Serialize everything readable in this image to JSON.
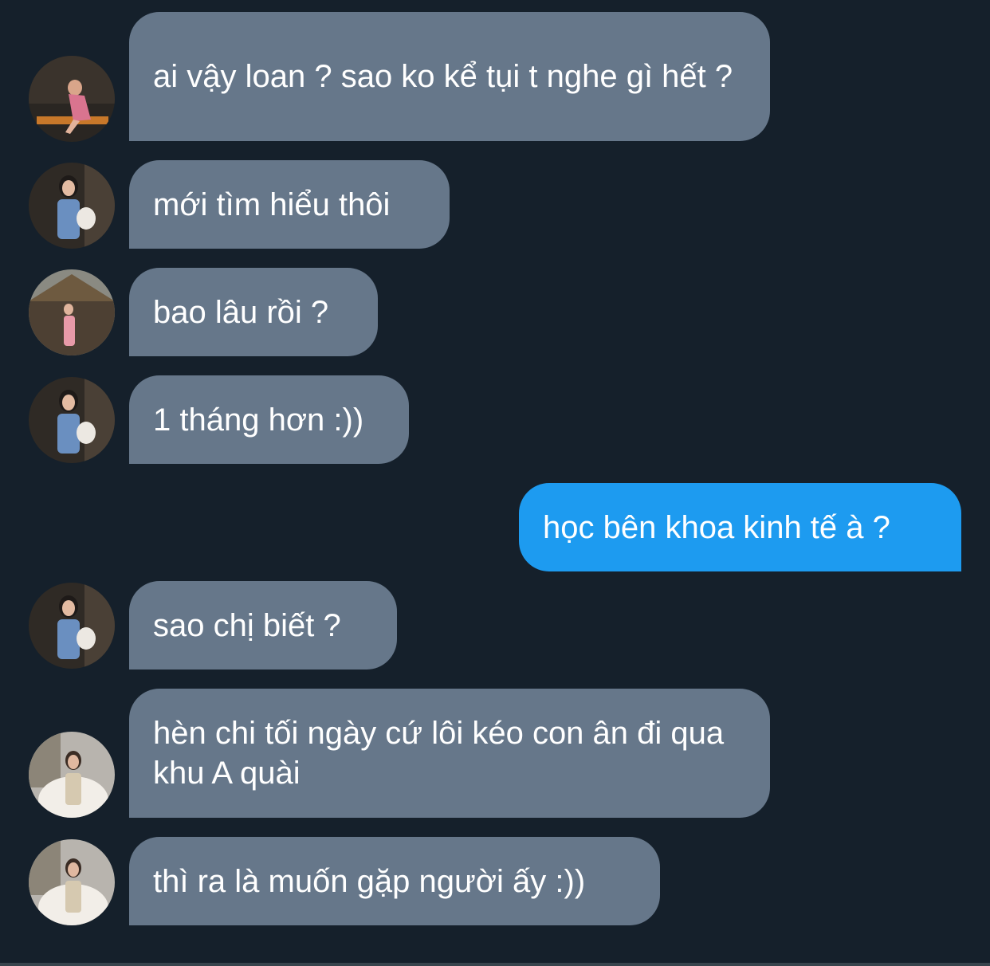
{
  "conversation": {
    "messages": [
      {
        "side": "in",
        "text": "ai vậy loan ? sao ko kể tụi t nghe gì hết ?",
        "avatar": "avatar-photo-woman-sitting"
      },
      {
        "side": "in",
        "text": "mới tìm hiểu thôi",
        "avatar": "avatar-photo-woman-denim"
      },
      {
        "side": "in",
        "text": "bao lâu rồi ?",
        "avatar": "avatar-photo-woman-hut"
      },
      {
        "side": "in",
        "text": "1 tháng hơn :))",
        "avatar": "avatar-photo-woman-denim"
      },
      {
        "side": "out",
        "text": "học bên khoa kinh tế à ?"
      },
      {
        "side": "in",
        "text": "sao chị biết ?",
        "avatar": "avatar-photo-woman-denim"
      },
      {
        "side": "in",
        "text": "hèn chi tối ngày cứ lôi kéo con ân đi qua khu A quài",
        "avatar": "avatar-photo-woman-fur"
      },
      {
        "side": "in",
        "text": "thì ra là muốn gặp người ấy :))",
        "avatar": "avatar-photo-woman-fur"
      }
    ]
  },
  "colors": {
    "background": "#15202b",
    "incoming_bubble": "#66778a",
    "outgoing_bubble": "#1d9bf0",
    "text": "#ffffff"
  }
}
